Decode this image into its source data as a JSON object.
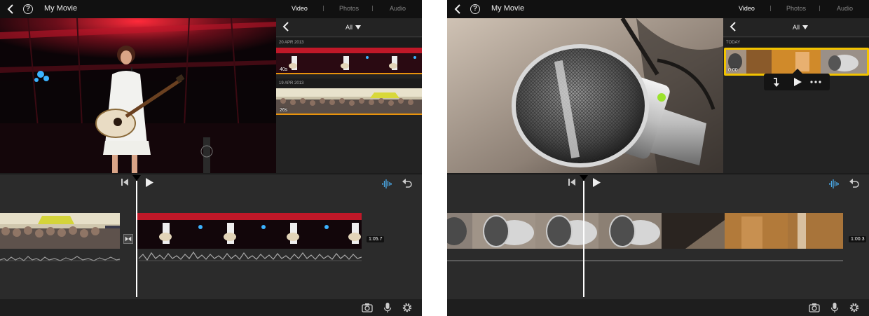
{
  "left": {
    "title": "My Movie",
    "help": "?",
    "tabs": [
      "Video",
      "Photos",
      "Audio"
    ],
    "filter": "All",
    "groups": [
      {
        "date": "20 APR 2013",
        "clips": [
          {
            "duration": "40s"
          }
        ]
      },
      {
        "date": "19 APR 2013",
        "clips": [
          {
            "duration": "26s"
          }
        ]
      }
    ],
    "timeline_duration": "1:05.7"
  },
  "right": {
    "title": "My Movie",
    "help": "?",
    "tabs": [
      "Video",
      "Photos",
      "Audio"
    ],
    "filter": "All",
    "groups": [
      {
        "date": "TODAY",
        "clips": [
          {
            "duration": "0:00"
          }
        ]
      }
    ],
    "timeline_duration": "1:00.3"
  },
  "icons": {
    "back": "chevron-left-icon",
    "help": "question-circle-icon",
    "skip_back": "skip-to-start-icon",
    "play": "play-icon",
    "waveform": "audio-waveform-icon",
    "undo": "undo-icon",
    "camera": "camera-icon",
    "microphone": "microphone-icon",
    "settings": "gear-icon",
    "add_to_project": "arrow-down-into-icon",
    "more": "more-dots-icon"
  },
  "colors": {
    "accent_orange": "#e8930c",
    "selection_yellow": "#f2c300",
    "waveform_blue": "#4aa8e6"
  }
}
